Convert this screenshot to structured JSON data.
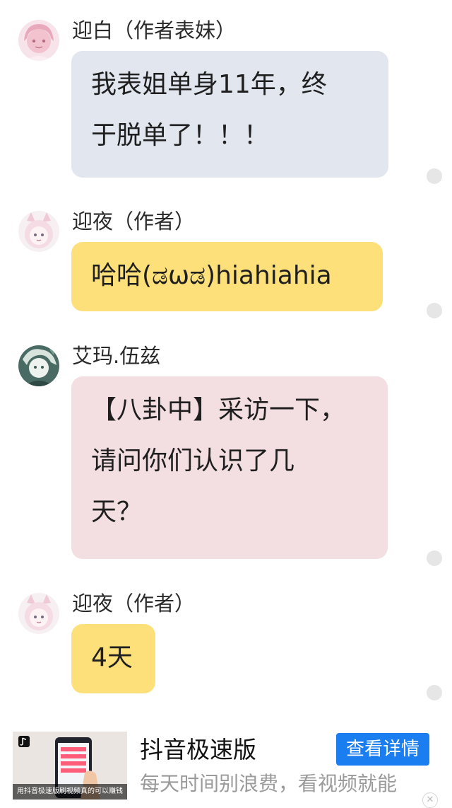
{
  "messages": [
    {
      "sender": "迎白（作者表妹）",
      "avatar_icon": "anime-girl-pink-avatar-icon",
      "lines": [
        "我表姐单身11年，终",
        "于脱单了！！！"
      ],
      "bubble_color": "#e1e6ef"
    },
    {
      "sender": "迎夜（作者）",
      "avatar_icon": "anime-girl-bunny-hood-avatar-icon",
      "lines": [
        "哈哈(ಡωಡ)hiahiahia"
      ],
      "bubble_color": "#fde07a"
    },
    {
      "sender": "艾玛.伍兹",
      "avatar_icon": "anime-character-green-avatar-icon",
      "lines": [
        "【八卦中】采访一下，",
        "请问你们认识了几",
        "天？"
      ],
      "bubble_color": "#f3dfe1"
    },
    {
      "sender": "迎夜（作者）",
      "avatar_icon": "anime-girl-bunny-hood-avatar-icon",
      "lines": [
        "4天"
      ],
      "bubble_color": "#fde07a"
    }
  ],
  "ad": {
    "title": "抖音极速版",
    "description": "每天时间别浪费，看视频就能",
    "button_label": "查看详情",
    "thumbnail_caption": "用抖音极速版刷视频真的可以赚钱",
    "close_label": "✕",
    "button_color": "#1a7df0"
  }
}
